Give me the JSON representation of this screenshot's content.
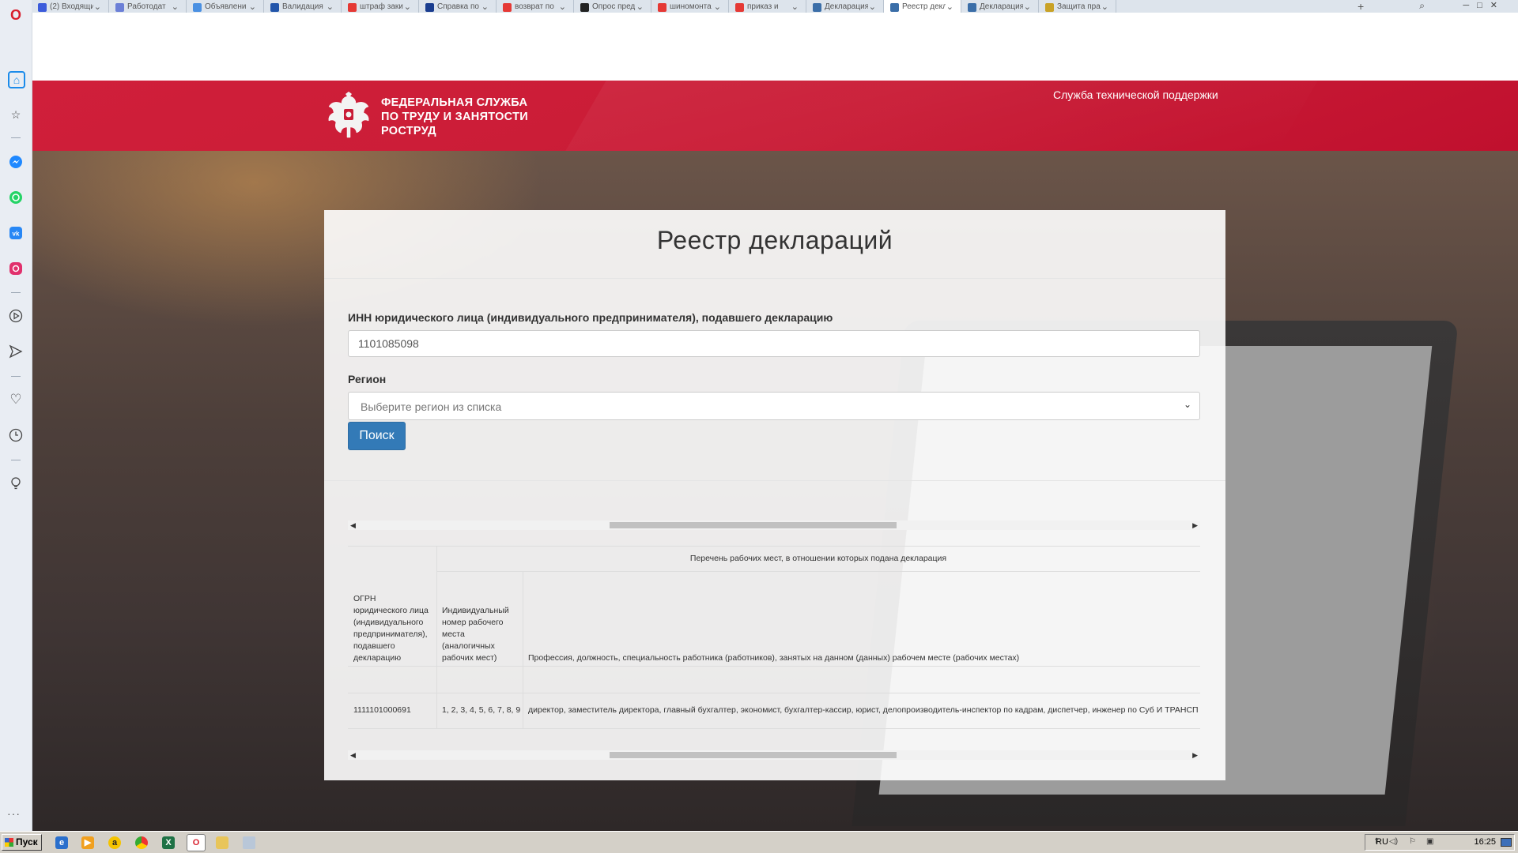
{
  "browser": {
    "tabs": [
      {
        "title": "(2) Входящи",
        "color": "#3b5bdb"
      },
      {
        "title": "Работодат",
        "color": "#6b7fd7"
      },
      {
        "title": "Объявлени",
        "color": "#4a90e2"
      },
      {
        "title": "Валидация",
        "color": "#2255aa"
      },
      {
        "title": "штраф заки",
        "color": "#e53935"
      },
      {
        "title": "Справка по",
        "color": "#1a3d8f"
      },
      {
        "title": "возврат по",
        "color": "#e53935"
      },
      {
        "title": "Опрос пред",
        "color": "#222222"
      },
      {
        "title": "шиномонта",
        "color": "#e53935"
      },
      {
        "title": "приказ и",
        "color": "#e53935"
      },
      {
        "title": "Декларация",
        "color": "#3b6ea8"
      },
      {
        "title": "Реестр декл",
        "color": "#3b6ea8",
        "active": true
      },
      {
        "title": "Декларация",
        "color": "#3b6ea8"
      },
      {
        "title": "Защита прав",
        "color": "#c9a227"
      }
    ],
    "new_tab": "+"
  },
  "sidebar": {
    "items": [
      {
        "name": "opera-logo-icon",
        "glyph": "O",
        "color": "#d81d2c"
      },
      {
        "name": "home-icon",
        "glyph": "⌂",
        "color": "#1b8bea"
      },
      {
        "name": "bookmarks-star-icon",
        "glyph": "☆",
        "color": "#444444"
      },
      {
        "name": "messenger-icon",
        "glyph": "m",
        "color": "#1e88ff"
      },
      {
        "name": "whatsapp-icon",
        "glyph": "w",
        "color": "#25d366"
      },
      {
        "name": "vk-icon",
        "glyph": "vk",
        "color": "#2787f5"
      },
      {
        "name": "instagram-icon",
        "glyph": "◎",
        "color": "#e1306c"
      },
      {
        "name": "player-icon",
        "glyph": "▷",
        "color": "#444444"
      },
      {
        "name": "send-icon",
        "glyph": "➢",
        "color": "#444444"
      },
      {
        "name": "heart-icon",
        "glyph": "♡",
        "color": "#444444"
      },
      {
        "name": "history-clock-icon",
        "glyph": "◷",
        "color": "#444444"
      },
      {
        "name": "lightbulb-icon",
        "glyph": "♁",
        "color": "#444444"
      }
    ],
    "more": "···"
  },
  "header": {
    "brand_line1": "ФЕДЕРАЛЬНАЯ СЛУЖБА",
    "brand_line2": "ПО ТРУДУ И ЗАНЯТОСТИ",
    "brand_line3": "РОСТРУД",
    "support_link": "Служба технической поддержки",
    "color": "#cc1d37"
  },
  "form": {
    "title": "Реестр деклараций",
    "inn_label": "ИНН юридического лица (индивидуального предпринимателя), подавшего декларацию",
    "inn_value": "1101085098",
    "region_label": "Регион",
    "region_placeholder": "Выберите регион из списка",
    "search_button": "Поиск",
    "button_color": "#337ab7"
  },
  "table": {
    "group_header": "Перечень рабочих мест, в отношении которых подана декларация",
    "columns": [
      "ОГРН юридического лица (индивидуального предпринимателя), подавшего декларацию",
      "Индивидуальный номер рабочего места (аналогичных рабочих мест)",
      "Профессия, должность, специальность работника (работников), занятых на данном (данных) рабочем месте (рабочих местах)"
    ],
    "rows": [
      [
        "1111101000691",
        "1, 2, 3, 4, 5, 6, 7, 8, 9",
        "директор, заместитель директора, главный бухгалтер, экономист, бухгалтер-кассир, юрист, делопроизводитель-инспектор по кадрам, диспетчер, инженер по Суб И ТРАНСП"
      ]
    ]
  },
  "taskbar": {
    "start": "Пуск",
    "lang": "RU",
    "time": "16:25"
  }
}
